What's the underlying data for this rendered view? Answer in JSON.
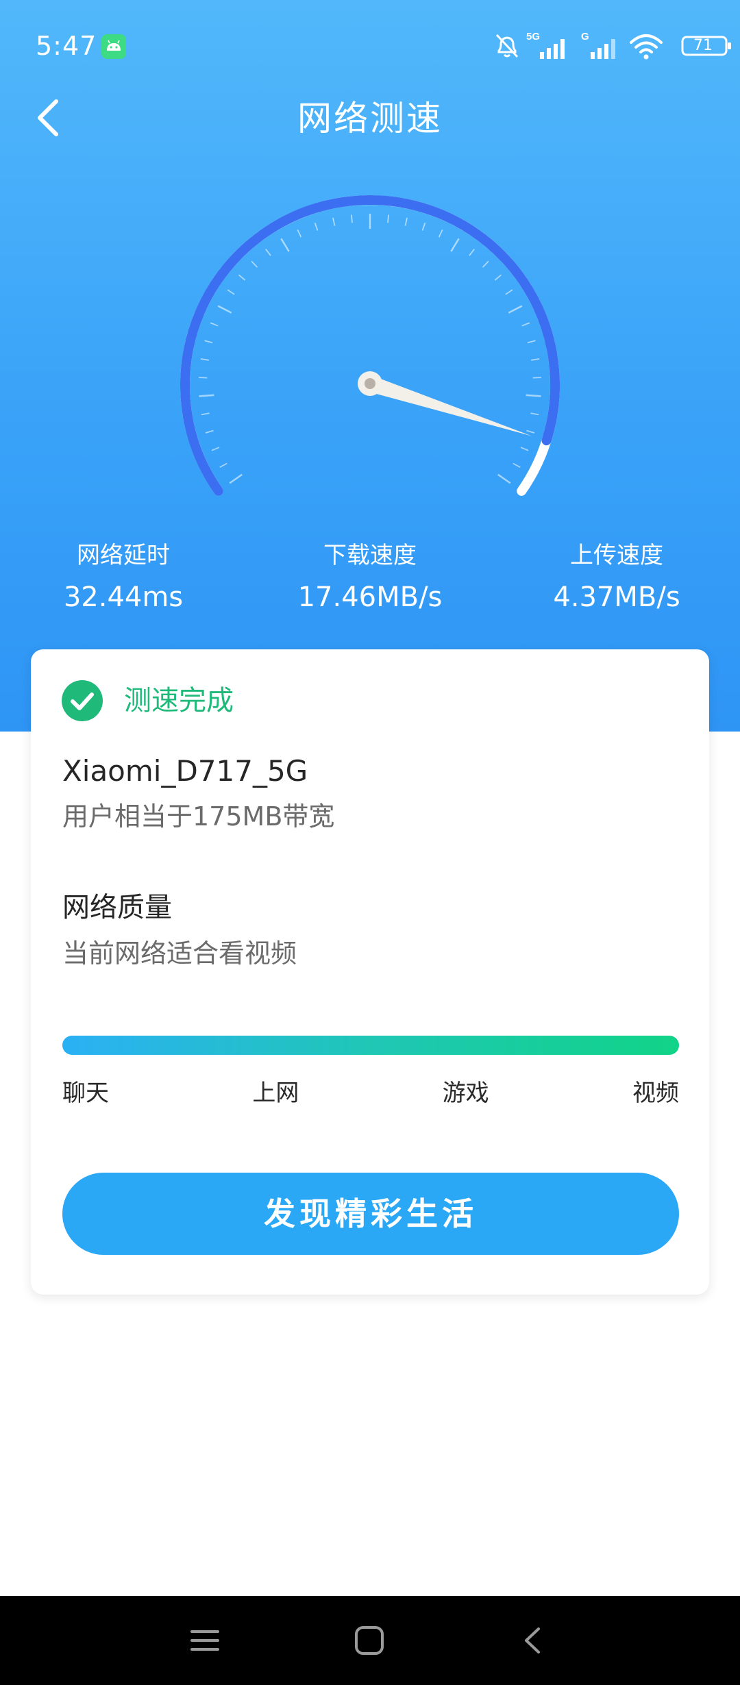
{
  "status_bar": {
    "time": "5:47",
    "battery_level": "71",
    "network_5g_label": "5G",
    "network_g_label": "G",
    "icons": [
      "android-icon",
      "mute-bell-icon",
      "signal-5g-icon",
      "signal-g-icon",
      "wifi-icon",
      "battery-icon"
    ]
  },
  "header": {
    "title": "网络测速",
    "back_icon": "back-chevron-icon"
  },
  "gauge": {
    "level_fraction": 0.93
  },
  "metrics": [
    {
      "label": "网络延时",
      "value": "32.44ms"
    },
    {
      "label": "下载速度",
      "value": "17.46MB/s"
    },
    {
      "label": "上传速度",
      "value": "4.37MB/s"
    }
  ],
  "result_card": {
    "status": "测速完成",
    "status_icon": "check-circle-icon",
    "network_name": "Xiaomi_D717_5G",
    "bandwidth": "用户相当于175MB带宽",
    "quality_title": "网络质量",
    "quality_desc": "当前网络适合看视频",
    "quality_levels": [
      "聊天",
      "上网",
      "游戏",
      "视频"
    ],
    "action_button": "发现精彩生活"
  },
  "colors": {
    "header_gradient_top": "#52b8fb",
    "header_gradient_bottom": "#2e95f5",
    "gauge_arc": "#3b6ef0",
    "status_green": "#1fb97a",
    "button_blue": "#2aa8f6"
  },
  "system_nav": {
    "icons": [
      "menu-icon",
      "home-icon",
      "back-icon"
    ]
  }
}
